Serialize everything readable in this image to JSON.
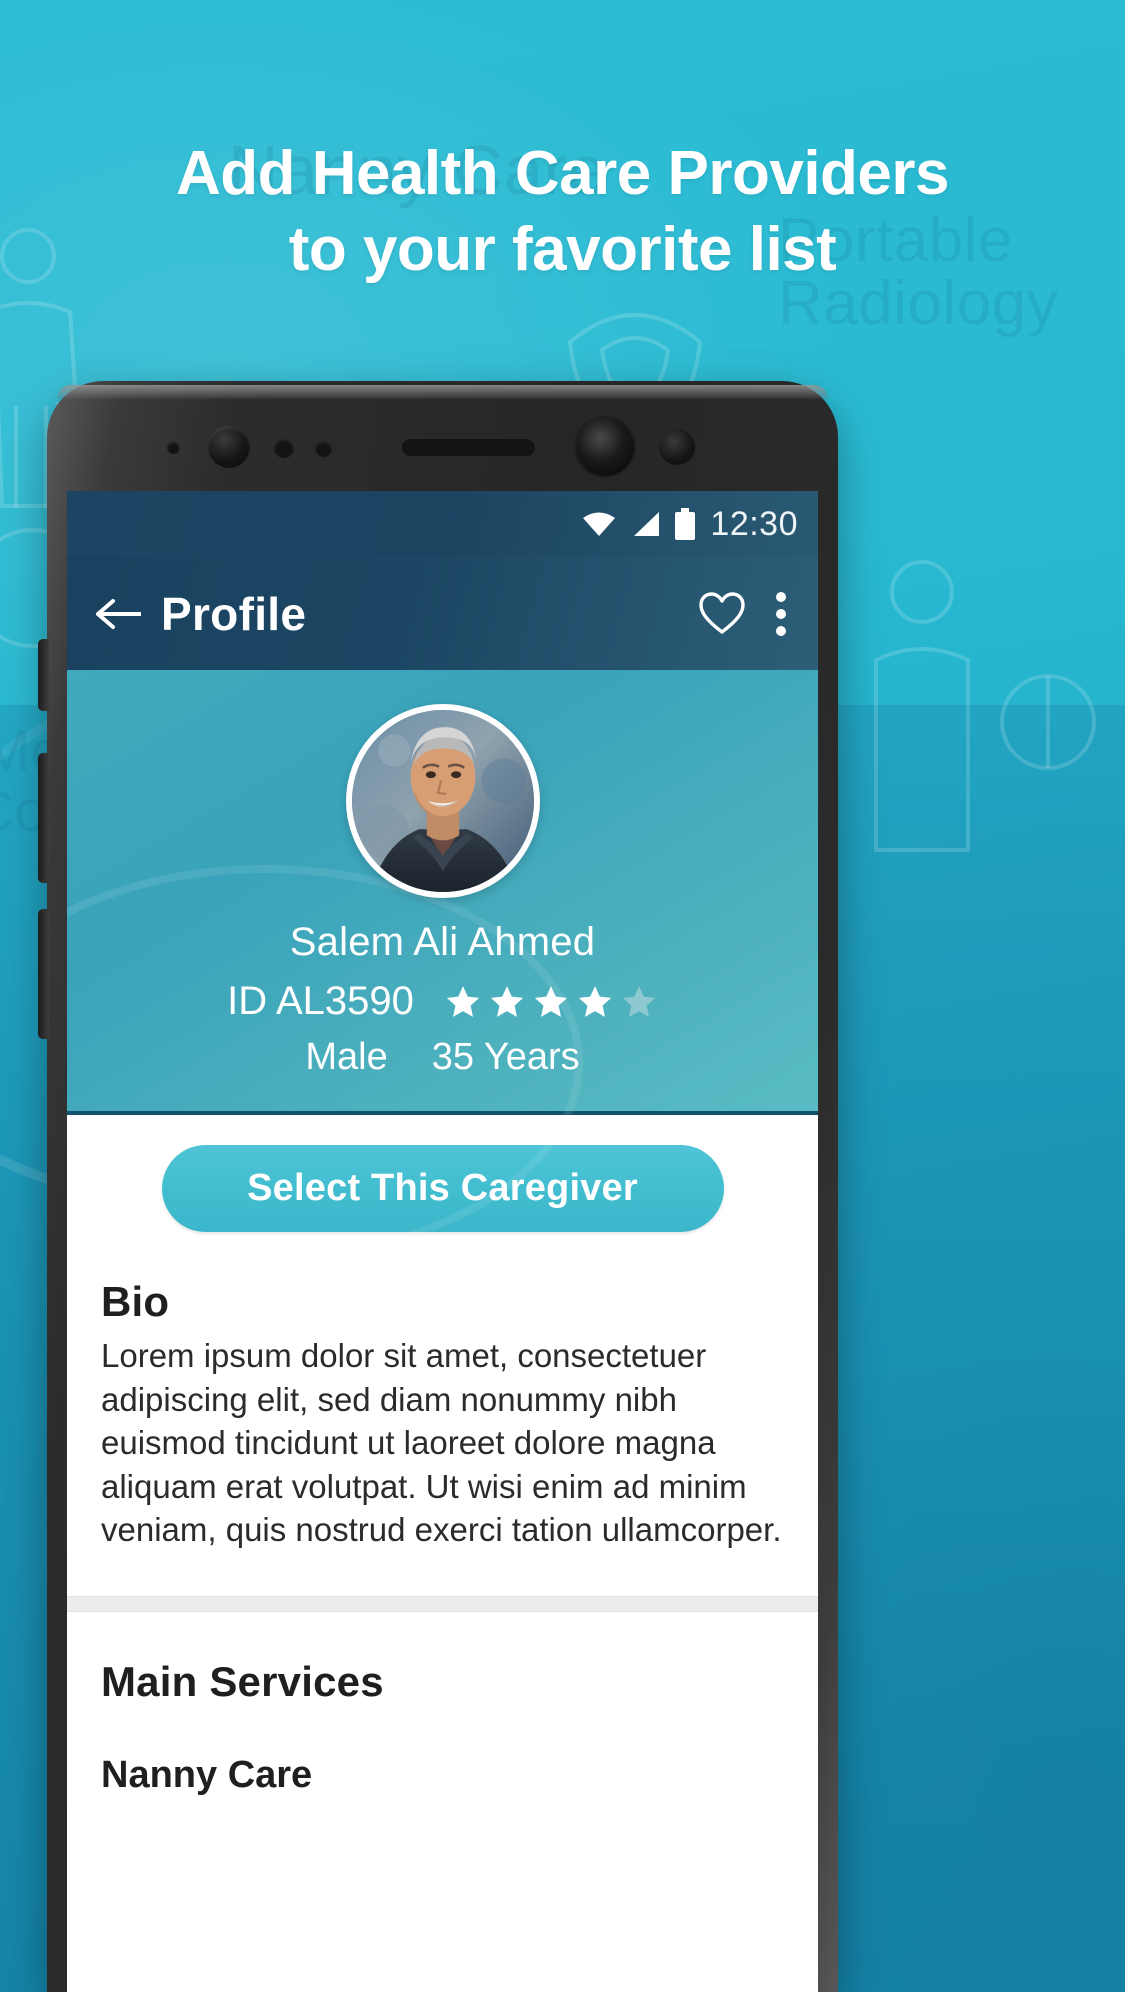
{
  "promo": {
    "headline_line1": "Add Health Care Providers",
    "headline_line2": "to your favorite list",
    "watermarks": {
      "nanny_care": "Nanny Care",
      "portable": "Portable",
      "radiology": "Radiology",
      "medical": "Medical",
      "consultation": "Consultation"
    },
    "accent_color": "#2bbcd4"
  },
  "statusbar": {
    "clock": "12:30",
    "wifi_icon": "wifi-icon",
    "signal_icon": "signal-icon",
    "battery_icon": "battery-icon"
  },
  "appbar": {
    "back_icon": "back-arrow-icon",
    "title": "Profile",
    "favorite_icon": "heart-outline-icon",
    "overflow_icon": "more-vertical-icon",
    "background_color": "#1c4563"
  },
  "profile": {
    "avatar_alt": "Salem Ali Ahmed profile photo",
    "name": "Salem Ali Ahmed",
    "id_label": "ID AL3590",
    "rating": 4,
    "rating_max": 5,
    "gender": "Male",
    "age": "35 Years",
    "header_color": "#3fa9bd"
  },
  "content": {
    "cta_label": "Select This Caregiver",
    "cta_color": "#41bdd0",
    "bio_title": "Bio",
    "bio_text": "Lorem ipsum dolor sit amet, consectetuer adipiscing elit, sed diam nonummy nibh euismod tincidunt ut laoreet dolore magna aliquam erat volutpat. Ut wisi enim ad minim veniam, quis nostrud exerci tation ullamcorper.",
    "services_title": "Main Services",
    "services": [
      {
        "name": "Nanny Care"
      }
    ]
  }
}
